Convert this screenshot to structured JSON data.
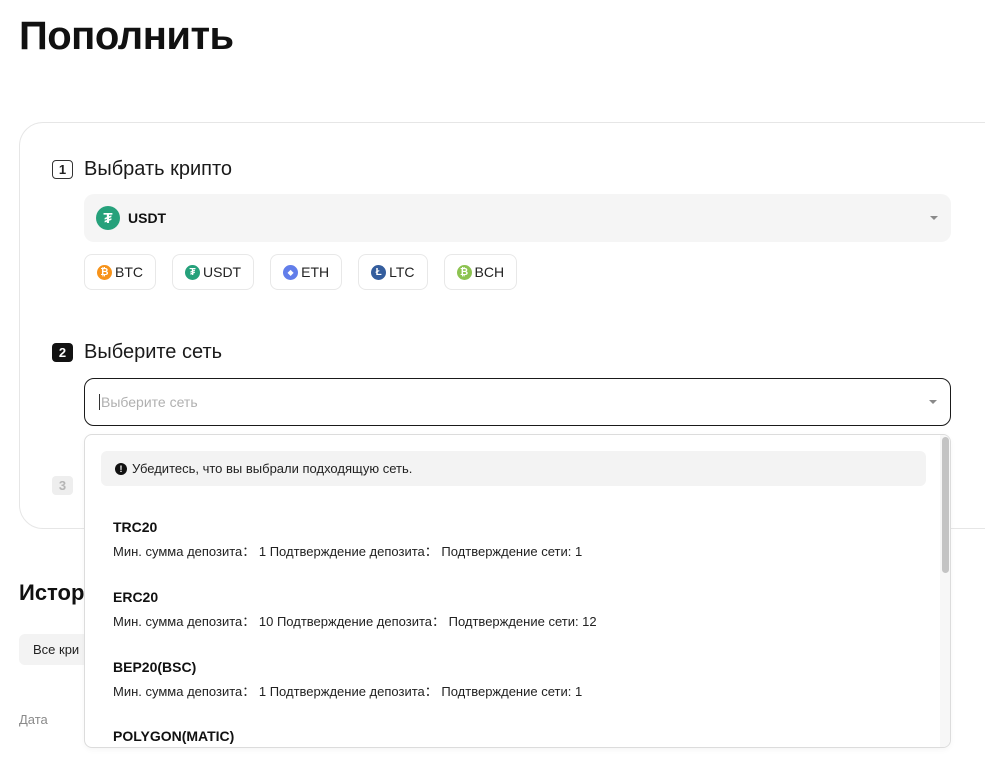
{
  "page": {
    "title": "Пополнить"
  },
  "step1": {
    "number": "1",
    "label": "Выбрать крипто",
    "selected": {
      "symbol": "USDT",
      "icon": "tether-icon"
    },
    "quick_chips": [
      {
        "label": "BTC",
        "icon": "bitcoin-icon",
        "color": "#f7931a",
        "glyph": "₿"
      },
      {
        "label": "USDT",
        "icon": "tether-icon",
        "color": "#26a17b",
        "glyph": "₮"
      },
      {
        "label": "ETH",
        "icon": "ethereum-icon",
        "color": "#627eea",
        "glyph": "◆"
      },
      {
        "label": "LTC",
        "icon": "litecoin-icon",
        "color": "#345d9d",
        "glyph": "Ł"
      },
      {
        "label": "BCH",
        "icon": "bitcoin-cash-icon",
        "color": "#8dc351",
        "glyph": "₿"
      }
    ]
  },
  "step2": {
    "number": "2",
    "label": "Выберите сеть",
    "placeholder": "Выберите сеть",
    "notice": "Убедитесь, что вы выбрали подходящую сеть.",
    "networks": [
      {
        "name": "TRC20",
        "details": "Мин. сумма депозита： 1 Подтверждение депозита： Подтверждение сети: 1"
      },
      {
        "name": "ERC20",
        "details": "Мин. сумма депозита： 10 Подтверждение депозита： Подтверждение сети: 12"
      },
      {
        "name": "BEP20(BSC)",
        "details": "Мин. сумма депозита： 1 Подтверждение депозита： Подтверждение сети: 1"
      },
      {
        "name": "POLYGON(MATIC)",
        "details": ""
      }
    ]
  },
  "step3": {
    "number": "3"
  },
  "history": {
    "title": "Истор",
    "filter_label": "Все кри",
    "column_date": "Дата"
  },
  "colors": {
    "accent": "#121212",
    "tether": "#26a17b"
  }
}
